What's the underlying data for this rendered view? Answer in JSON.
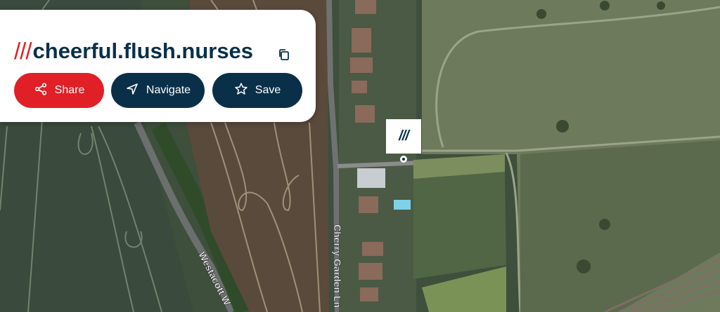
{
  "address": {
    "slashes": "///",
    "words": "cheerful.flush.nurses"
  },
  "actions": {
    "share": "Share",
    "navigate": "Navigate",
    "save": "Save"
  },
  "marker": {
    "label": "///"
  },
  "map_labels": {
    "road_left": "Westacott W",
    "road_middle": "Cherry Garden Ln"
  },
  "icons": {
    "copy": "copy-icon",
    "share": "share-icon",
    "navigate": "navigate-icon",
    "save": "star-icon"
  },
  "colors": {
    "brand_red": "#e11f26",
    "brand_navy": "#0a3049",
    "card": "#ffffff"
  }
}
